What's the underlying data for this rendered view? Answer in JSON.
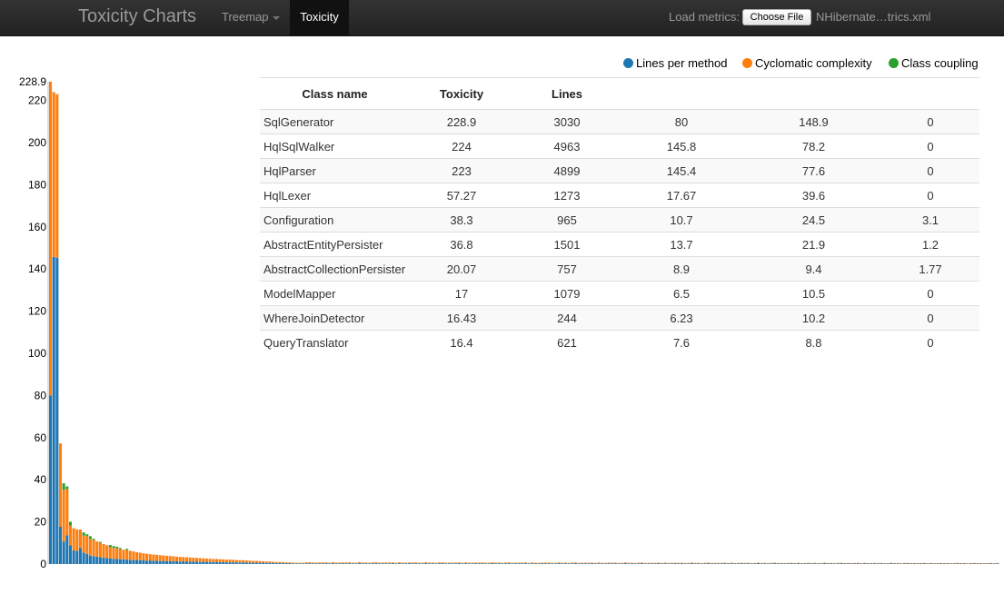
{
  "navbar": {
    "brand": "Toxicity Charts",
    "menu_treemap": "Treemap",
    "menu_toxicity": "Toxicity",
    "load_label": "Load metrics:",
    "choose_file_label": "Choose File",
    "file_name": "NHibernate…trics.xml"
  },
  "legend": [
    {
      "label": "Lines per method",
      "color": "#1f77b4"
    },
    {
      "label": "Cyclomatic complexity",
      "color": "#ff7f0e"
    },
    {
      "label": "Class coupling",
      "color": "#2ca02c"
    }
  ],
  "table": {
    "headers": [
      "Class name",
      "Toxicity",
      "Lines",
      "",
      "",
      ""
    ],
    "rows": [
      [
        "SqlGenerator",
        "228.9",
        "3030",
        "80",
        "148.9",
        "0"
      ],
      [
        "HqlSqlWalker",
        "224",
        "4963",
        "145.8",
        "78.2",
        "0"
      ],
      [
        "HqlParser",
        "223",
        "4899",
        "145.4",
        "77.6",
        "0"
      ],
      [
        "HqlLexer",
        "57.27",
        "1273",
        "17.67",
        "39.6",
        "0"
      ],
      [
        "Configuration",
        "38.3",
        "965",
        "10.7",
        "24.5",
        "3.1"
      ],
      [
        "AbstractEntityPersister",
        "36.8",
        "1501",
        "13.7",
        "21.9",
        "1.2"
      ],
      [
        "AbstractCollectionPersister",
        "20.07",
        "757",
        "8.9",
        "9.4",
        "1.77"
      ],
      [
        "ModelMapper",
        "17",
        "1079",
        "6.5",
        "10.5",
        "0"
      ],
      [
        "WhereJoinDetector",
        "16.43",
        "244",
        "6.23",
        "10.2",
        "0"
      ],
      [
        "QueryTranslator",
        "16.4",
        "621",
        "7.6",
        "8.8",
        "0"
      ]
    ]
  },
  "chart_data": {
    "type": "bar",
    "stacked": true,
    "ylim": [
      0,
      228.9
    ],
    "y_ticks": [
      "0",
      "20",
      "40",
      "60",
      "80",
      "100",
      "120",
      "140",
      "160",
      "180",
      "200",
      "220",
      "228.9"
    ],
    "series_colors": [
      "#1f77b4",
      "#ff7f0e",
      "#2ca02c"
    ],
    "series_names": [
      "Lines per method",
      "Cyclomatic complexity",
      "Class coupling"
    ],
    "values": [
      [
        80,
        148.9,
        0
      ],
      [
        145.8,
        78.2,
        0
      ],
      [
        145.4,
        77.6,
        0
      ],
      [
        17.67,
        39.6,
        0
      ],
      [
        10.7,
        24.5,
        3.1
      ],
      [
        13.7,
        21.9,
        1.2
      ],
      [
        8.9,
        9.4,
        1.77
      ],
      [
        6.5,
        10.5,
        0
      ],
      [
        6.23,
        10.2,
        0
      ],
      [
        7.6,
        8.8,
        0
      ],
      [
        5.5,
        8.0,
        1.5
      ],
      [
        4.8,
        8.5,
        0.8
      ],
      [
        4.0,
        8.0,
        1.2
      ],
      [
        3.8,
        7.6,
        0.6
      ],
      [
        3.5,
        7.2,
        0
      ],
      [
        3.2,
        6.8,
        0.5
      ],
      [
        3.0,
        6.5,
        0
      ],
      [
        2.9,
        6.0,
        0
      ],
      [
        2.6,
        5.4,
        1.0
      ],
      [
        2.5,
        5.2,
        0.8
      ],
      [
        2.4,
        5.0,
        0.8
      ],
      [
        2.3,
        4.8,
        0.5
      ],
      [
        2.2,
        4.6,
        0
      ],
      [
        2.1,
        4.5,
        0.6
      ],
      [
        2.0,
        4.3,
        0
      ],
      [
        1.9,
        4.1,
        0
      ],
      [
        2.0,
        3.6,
        0
      ],
      [
        1.8,
        3.6,
        0
      ],
      [
        1.9,
        3.2,
        0
      ],
      [
        1.6,
        3.3,
        0
      ],
      [
        1.7,
        3.0,
        0
      ],
      [
        1.5,
        3.0,
        0
      ],
      [
        1.6,
        2.8,
        0
      ],
      [
        1.4,
        2.8,
        0
      ],
      [
        1.5,
        2.6,
        0
      ],
      [
        1.4,
        2.5,
        0
      ],
      [
        1.3,
        2.5,
        0
      ],
      [
        1.4,
        2.3,
        0
      ],
      [
        1.3,
        2.2,
        0
      ],
      [
        1.2,
        2.2,
        0
      ],
      [
        1.3,
        2.0,
        0
      ],
      [
        1.2,
        2.0,
        0
      ],
      [
        1.1,
        2.0,
        0
      ],
      [
        1.2,
        1.8,
        0
      ],
      [
        1.1,
        1.8,
        0
      ],
      [
        1.0,
        1.8,
        0
      ],
      [
        1.1,
        1.6,
        0
      ],
      [
        1.0,
        1.6,
        0
      ],
      [
        1.0,
        1.5,
        0
      ],
      [
        0.9,
        1.5,
        0
      ],
      [
        1.0,
        1.4,
        0
      ],
      [
        0.9,
        1.4,
        0
      ],
      [
        0.9,
        1.3,
        0
      ],
      [
        0.8,
        1.3,
        0
      ],
      [
        0.9,
        1.2,
        0
      ],
      [
        0.8,
        1.2,
        0
      ],
      [
        0.8,
        1.1,
        0
      ],
      [
        0.7,
        1.1,
        0
      ],
      [
        0.8,
        1.0,
        0
      ],
      [
        0.7,
        1.0,
        0
      ],
      [
        0.7,
        0.9,
        0
      ],
      [
        0.6,
        0.9,
        0
      ],
      [
        0.7,
        0.8,
        0
      ],
      [
        0.6,
        0.8,
        0
      ],
      [
        0.6,
        0.7,
        0
      ],
      [
        0.5,
        0.7,
        0
      ],
      [
        0.6,
        0.6,
        0
      ],
      [
        0.5,
        0.6,
        0
      ],
      [
        0.5,
        0.5,
        0
      ],
      [
        0.5,
        0.5,
        0
      ],
      [
        0.4,
        0.5,
        0
      ],
      [
        0.4,
        0.4,
        0
      ],
      [
        0.4,
        0.4,
        0
      ],
      [
        0.3,
        0.4,
        0
      ],
      [
        0.3,
        0.3,
        0
      ],
      [
        0.3,
        0.3,
        0
      ]
    ]
  }
}
